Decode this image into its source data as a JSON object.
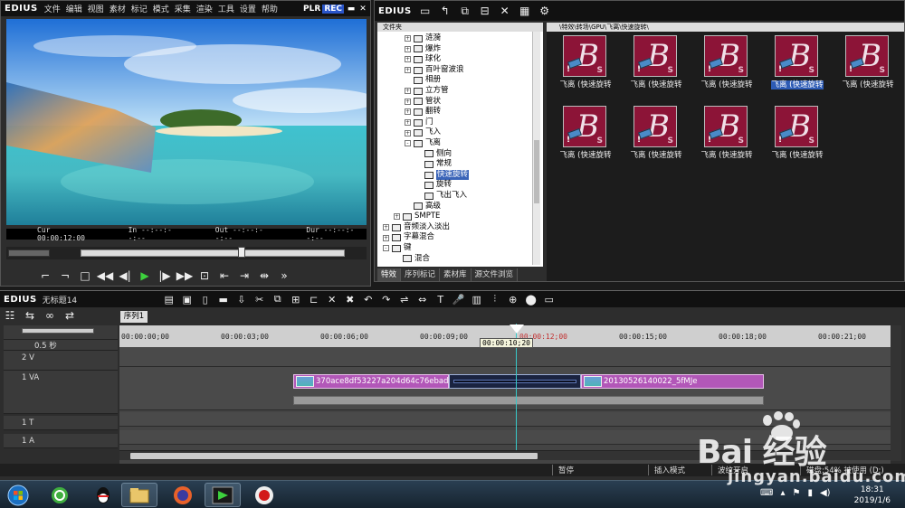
{
  "player": {
    "logo": "EDIUS",
    "menu": [
      "文件",
      "编辑",
      "视图",
      "素材",
      "标记",
      "模式",
      "采集",
      "渲染",
      "工具",
      "设置",
      "帮助"
    ],
    "plr": "PLR",
    "rec": "REC",
    "timecodes": {
      "cur": "Cur 00:00:12:00",
      "in": "In --:--:--:--",
      "out": "Out --:--:--:--",
      "dur": "Dur --:--:--:--"
    }
  },
  "effects": {
    "logo": "EDIUS",
    "tree_header": "文件夹",
    "path": "\\特效\\转场\\GPU\\飞离\\快速旋转\\",
    "tree": [
      {
        "label": "涟漪",
        "indent": 3,
        "expand": "+"
      },
      {
        "label": "爆炸",
        "indent": 3,
        "expand": "+"
      },
      {
        "label": "球化",
        "indent": 3,
        "expand": "+"
      },
      {
        "label": "百叶窗波浪",
        "indent": 3,
        "expand": "+"
      },
      {
        "label": "相册",
        "indent": 3,
        "expand": ""
      },
      {
        "label": "立方管",
        "indent": 3,
        "expand": "+"
      },
      {
        "label": "管状",
        "indent": 3,
        "expand": "+"
      },
      {
        "label": "翻转",
        "indent": 3,
        "expand": "+"
      },
      {
        "label": "门",
        "indent": 3,
        "expand": "+"
      },
      {
        "label": "飞入",
        "indent": 3,
        "expand": "+"
      },
      {
        "label": "飞离",
        "indent": 3,
        "expand": "-"
      },
      {
        "label": "侧向",
        "indent": 4,
        "expand": ""
      },
      {
        "label": "常规",
        "indent": 4,
        "expand": ""
      },
      {
        "label": "快速旋转",
        "indent": 4,
        "expand": "",
        "selected": true
      },
      {
        "label": "旋转",
        "indent": 4,
        "expand": ""
      },
      {
        "label": "飞出飞入",
        "indent": 4,
        "expand": ""
      },
      {
        "label": "高级",
        "indent": 3,
        "expand": ""
      },
      {
        "label": "SMPTE",
        "indent": 2,
        "expand": "+"
      },
      {
        "label": "音频淡入淡出",
        "indent": 1,
        "expand": "+"
      },
      {
        "label": "字幕混合",
        "indent": 1,
        "expand": "+"
      },
      {
        "label": "键",
        "indent": 1,
        "expand": "-"
      },
      {
        "label": "混合",
        "indent": 2,
        "expand": ""
      }
    ],
    "tabs": [
      "特效",
      "序列标记",
      "素材库",
      "源文件浏览"
    ],
    "thumbs": [
      {
        "label": "飞离 (快速旋转",
        "selected": false
      },
      {
        "label": "飞离 (快速旋转",
        "selected": false
      },
      {
        "label": "飞离 (快速旋转",
        "selected": false
      },
      {
        "label": "飞离 (快速旋转",
        "selected": true
      },
      {
        "label": "飞离 (快速旋转",
        "selected": false
      },
      {
        "label": "飞离 (快速旋转",
        "selected": false
      },
      {
        "label": "飞离 (快速旋转",
        "selected": false
      },
      {
        "label": "飞离 (快速旋转",
        "selected": false
      },
      {
        "label": "飞离 (快速旋转",
        "selected": false
      }
    ],
    "thumb_letter": "B",
    "thumb_s": "S",
    "thumb_excl": "!"
  },
  "timeline": {
    "logo": "EDIUS",
    "project_name": "无标题14",
    "sequence_tab": "序列1",
    "zoom": "0.5 秒",
    "ruler": [
      {
        "label": "00:00:00;00",
        "red": false
      },
      {
        "label": "00:00:03;00",
        "red": false
      },
      {
        "label": "00:00:06;00",
        "red": false
      },
      {
        "label": "00:00:09;00",
        "red": false
      },
      {
        "label": "00:00:12;00",
        "red": true
      },
      {
        "label": "00:00:15;00",
        "red": false
      },
      {
        "label": "00:00:18;00",
        "red": false
      },
      {
        "label": "00:00:21;00",
        "red": false
      }
    ],
    "playhead_tip": "00:00:10;20",
    "tracks": {
      "v2": "2 V",
      "va1": "1 VA",
      "t1": "1 T",
      "a1": "1 A"
    },
    "clips": {
      "clip1": "370ace8df53227a204d64c76ebad...",
      "clip2": "20130526140022_5fMJe"
    },
    "status": {
      "pause": "暂停",
      "insert": "插入模式",
      "ripple": "波纹开启",
      "disk": "磁盘:54% 被使用 (D:)"
    }
  },
  "taskbar": {
    "time": "18:31",
    "date": "2019/1/6"
  },
  "watermark": {
    "brand": "Bai 经验",
    "url": "jingyan.baidu.com"
  }
}
